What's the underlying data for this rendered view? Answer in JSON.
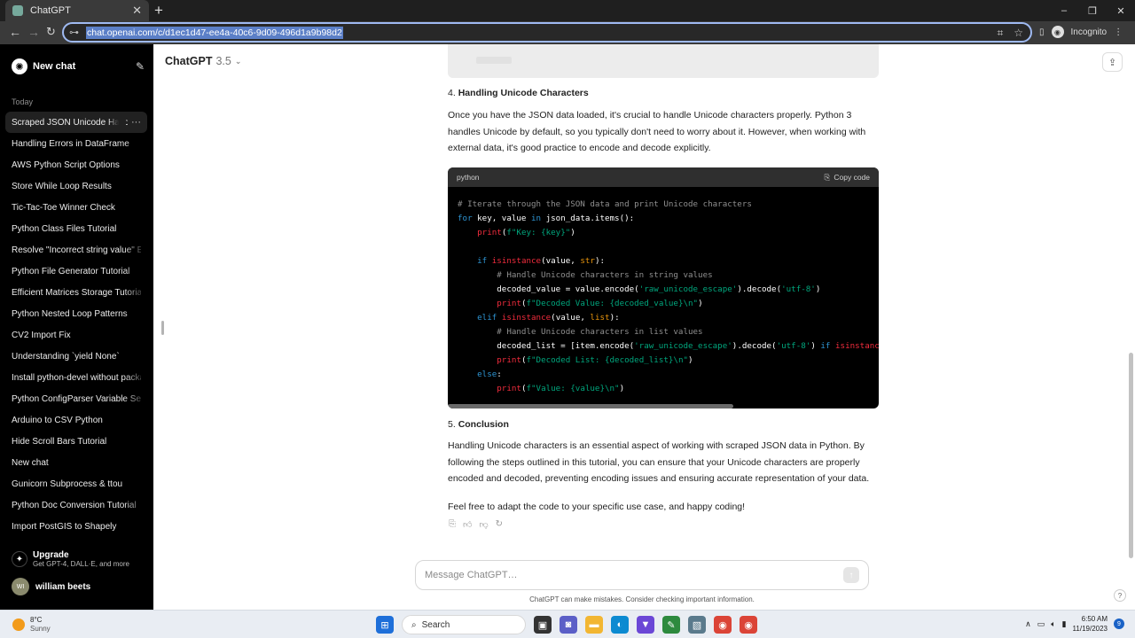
{
  "browser": {
    "tab_title": "ChatGPT",
    "tab_close": "✕",
    "new_tab": "+",
    "url": "chat.openai.com/c/d1ec1d47-ee4a-40c6-9d09-496d1a9b98d2",
    "profile_label": "Incognito",
    "window_controls": [
      "–",
      "❐",
      "✕"
    ]
  },
  "sidebar": {
    "new_chat": "New chat",
    "section": "Today",
    "items": [
      {
        "label": "Scraped JSON Unicode Handling",
        "active": true
      },
      {
        "label": "Handling Errors in DataFrame"
      },
      {
        "label": "AWS Python Script Options"
      },
      {
        "label": "Store While Loop Results"
      },
      {
        "label": "Tic-Tac-Toe Winner Check"
      },
      {
        "label": "Python Class Files Tutorial"
      },
      {
        "label": "Resolve \"Incorrect string value\" Error"
      },
      {
        "label": "Python File Generator Tutorial"
      },
      {
        "label": "Efficient Matrices Storage Tutorial"
      },
      {
        "label": "Python Nested Loop Patterns"
      },
      {
        "label": "CV2 Import Fix"
      },
      {
        "label": "Understanding `yield None`"
      },
      {
        "label": "Install python-devel without package"
      },
      {
        "label": "Python ConfigParser Variable Sections"
      },
      {
        "label": "Arduino to CSV Python"
      },
      {
        "label": "Hide Scroll Bars Tutorial"
      },
      {
        "label": "New chat"
      },
      {
        "label": "Gunicorn Subprocess & ttou"
      },
      {
        "label": "Python Doc Conversion Tutorial"
      },
      {
        "label": "Import PostGIS to Shapely"
      }
    ],
    "upgrade_title": "Upgrade",
    "upgrade_sub": "Get GPT-4, DALL·E, and more",
    "user_initials": "WI",
    "user_name": "william beets"
  },
  "header": {
    "model": "ChatGPT",
    "version": "3.5"
  },
  "message": {
    "step4_num": "4.",
    "step4_title": "Handling Unicode Characters",
    "step4_text": "Once you have the JSON data loaded, it's crucial to handle Unicode characters properly. Python 3 handles Unicode by default, so you typically don't need to worry about it. However, when working with external data, it's good practice to encode and decode explicitly.",
    "code_lang": "python",
    "copy_label": "Copy code",
    "step5_num": "5.",
    "step5_title": "Conclusion",
    "step5_text": "Handling Unicode characters is an essential aspect of working with scraped JSON data in Python. By following the steps outlined in this tutorial, you can ensure that your Unicode characters are properly encoded and decoded, preventing encoding issues and ensuring accurate representation of your data.",
    "closing": "Feel free to adapt the code to your specific use case, and happy coding!"
  },
  "composer": {
    "placeholder": "Message ChatGPT…",
    "disclaimer": "ChatGPT can make mistakes. Consider checking important information.",
    "help": "?"
  },
  "taskbar": {
    "temp": "8°C",
    "condition": "Sunny",
    "search": "Search",
    "time": "6:50 AM",
    "date": "11/19/2023",
    "notifications": "9"
  },
  "colors": {
    "sidebar_bg": "#000000",
    "code_bg": "#000000",
    "accent_url": "#5b7fc7"
  }
}
